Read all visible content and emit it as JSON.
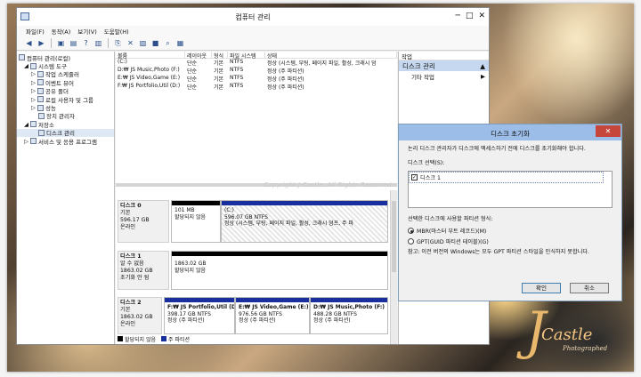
{
  "window": {
    "title": "컴퓨터 관리",
    "minimize": "─",
    "maximize": "□",
    "close": "✕"
  },
  "menu": [
    "파일(F)",
    "동작(A)",
    "보기(V)",
    "도움말(H)"
  ],
  "tree": [
    {
      "label": "컴퓨터 관리(로컬)",
      "indent": 0
    },
    {
      "label": "시스템 도구",
      "indent": 1
    },
    {
      "label": "작업 스케줄러",
      "indent": 2
    },
    {
      "label": "이벤트 뷰어",
      "indent": 2
    },
    {
      "label": "공유 폴더",
      "indent": 2
    },
    {
      "label": "로컬 사용자 및 그룹",
      "indent": 2
    },
    {
      "label": "성능",
      "indent": 2
    },
    {
      "label": "장치 관리자",
      "indent": 2
    },
    {
      "label": "저장소",
      "indent": 1
    },
    {
      "label": "디스크 관리",
      "indent": 2
    },
    {
      "label": "서비스 및 응용 프로그램",
      "indent": 1
    }
  ],
  "volume_table": {
    "headers": [
      "볼륨",
      "레이아웃",
      "형식",
      "파일 시스템",
      "상태"
    ],
    "rows": [
      [
        "(C:)",
        "단순",
        "기본",
        "NTFS",
        "정상 (시스템, 부팅, 페이지 파일, 활성, 크래시 덤"
      ],
      [
        "D:₩ JS Music,Photo (F:)",
        "단순",
        "기본",
        "NTFS",
        "정상 (주 파티션)"
      ],
      [
        "E:₩ JS Video,Game (E:)",
        "단순",
        "기본",
        "NTFS",
        "정상 (주 파티션)"
      ],
      [
        "F:₩ JS Portfolio,Util (D:)",
        "단순",
        "기본",
        "NTFS",
        "정상 (주 파티션)"
      ]
    ]
  },
  "watermark": "Copyright J-Castle. All Rights Reserved.",
  "disks": {
    "disk0": {
      "info": [
        "디스크 0",
        "기본",
        "596.17 GB",
        "온라인"
      ],
      "parts": [
        {
          "lines": [
            "",
            "101 MB",
            "할당되지 않음"
          ]
        },
        {
          "lines": [
            "(C:)",
            "596.07 GB NTFS",
            "정상 (시스템, 부팅, 페이지 파일, 활성, 크래시 덤프, 주 파"
          ]
        }
      ]
    },
    "disk1": {
      "info": [
        "디스크 1",
        "알 수 없음",
        "1863.02 GB",
        "초기화 안 됨"
      ],
      "parts": [
        {
          "lines": [
            "",
            "1863.02 GB",
            "할당되지 않음"
          ]
        }
      ]
    },
    "disk2": {
      "info": [
        "디스크 2",
        "기본",
        "1863.02 GB",
        "온라인"
      ],
      "parts": [
        {
          "lines": [
            "F:₩ JS Portfolio,Util  (D:",
            "398.17 GB NTFS",
            "정상 (주 파티션)"
          ]
        },
        {
          "lines": [
            "E:₩ JS Video,Game  (E:)",
            "976.56 GB NTFS",
            "정상 (주 파티션)"
          ]
        },
        {
          "lines": [
            "D:₩ JS Music,Photo  (F:)",
            "488.28 GB NTFS",
            "정상 (주 파티션)"
          ]
        }
      ]
    }
  },
  "legend": [
    "할당되지 않음",
    "주 파티션"
  ],
  "actions": {
    "header": "작업",
    "selected": "디스크 관리",
    "item": "기타 작업"
  },
  "dialog": {
    "title": "디스크 초기화",
    "intro": "논리 디스크 관리자가 디스크에 액세스하기 전에 디스크를 초기화해야 합니다.",
    "select_label": "디스크 선택(S):",
    "disk_item": "디스크 1",
    "style_label": "선택한 디스크에 사용할 파티션 형식:",
    "mbr": "MBR(마스터 부트 레코드)(M)",
    "gpt": "GPT(GUID 파티션 테이블)(G)",
    "note": "참고: 이전 버전의 Windows는 모두 GPT 파티션 스타일을 인식하지 못합니다.",
    "ok": "확인",
    "cancel": "취소"
  },
  "logo": {
    "initial": "J",
    "word": "Castle",
    "sub": "Photographed"
  },
  "colors": {
    "primary_partition": "#1a2f9e",
    "unallocated": "#000000",
    "selection": "#c6d8ef"
  }
}
